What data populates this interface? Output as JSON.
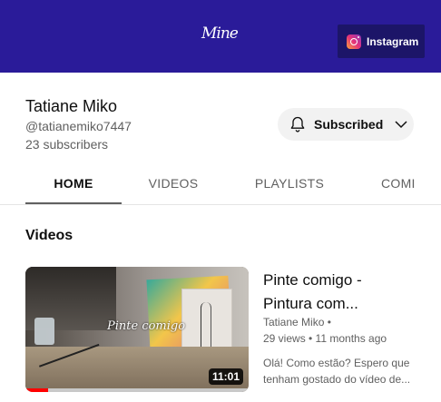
{
  "banner": {
    "logo_text": "Mine",
    "link_label": "Instagram",
    "link_icon": "instagram-icon",
    "color": "#2a1b99"
  },
  "channel": {
    "name": "Tatiane Miko",
    "handle": "@tatianemiko7447",
    "subscribers": "23 subscribers",
    "subscribe_label": "Subscribed"
  },
  "tabs": [
    "HOME",
    "VIDEOS",
    "PLAYLISTS",
    "COMI"
  ],
  "section": {
    "title": "Videos"
  },
  "video": {
    "thumbnail_caption": "Pinte comigo",
    "duration": "11:01",
    "progress": 0.1,
    "title_line1": "Pinte comigo -",
    "title_line2": "Pintura com...",
    "channel": "Tatiane Miko •",
    "meta": "29 views • 11 months ago",
    "desc_line1": "Olá! Como estão? Espero que",
    "desc_line2": "tenham gostado do vídeo de..."
  }
}
